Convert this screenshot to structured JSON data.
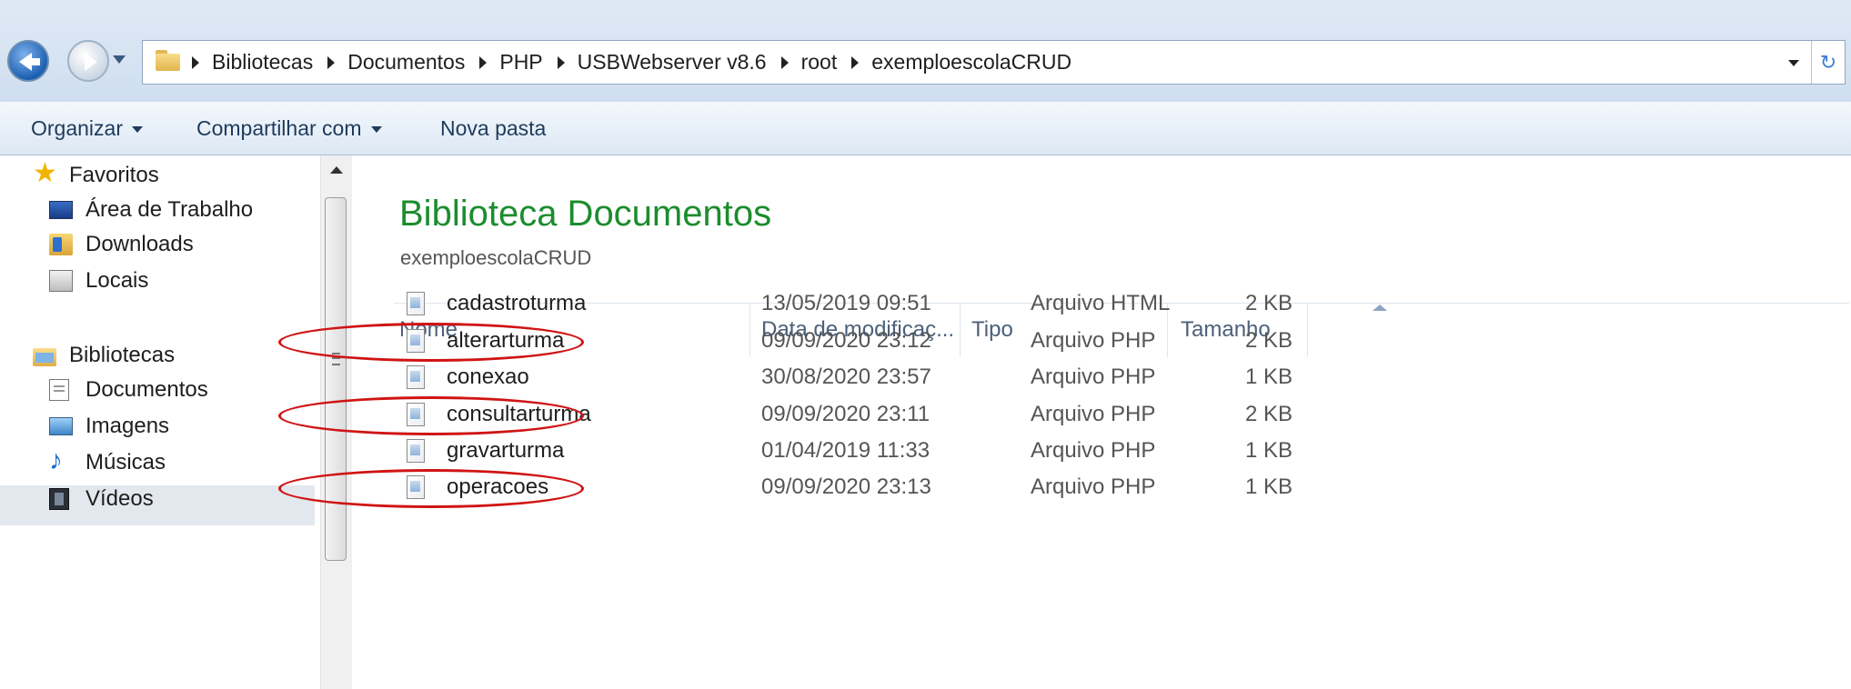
{
  "address_bar": {
    "breadcrumbs": [
      "Bibliotecas",
      "Documentos",
      "PHP",
      "USBWebserver v8.6",
      "root",
      "exemploescolaCRUD"
    ]
  },
  "toolbar": {
    "organize": "Organizar",
    "share": "Compartilhar com",
    "new_folder": "Nova pasta"
  },
  "sidebar": {
    "favorites_header": "Favoritos",
    "favorites": [
      "Área de Trabalho",
      "Downloads",
      "Locais"
    ],
    "libraries_header": "Bibliotecas",
    "libraries": [
      "Documentos",
      "Imagens",
      "Músicas",
      "Vídeos"
    ],
    "selected": "Documentos"
  },
  "library": {
    "title": "Biblioteca Documentos",
    "subtitle": "exemploescolaCRUD"
  },
  "columns": {
    "name": "Nome",
    "date": "Data de modificaç...",
    "type": "Tipo",
    "size": "Tamanho"
  },
  "files": [
    {
      "name": "cadastroturma",
      "date": "13/05/2019 09:51",
      "type": "Arquivo HTML",
      "size": "2 KB",
      "circled": false
    },
    {
      "name": "alterarturma",
      "date": "09/09/2020 23:12",
      "type": "Arquivo PHP",
      "size": "2 KB",
      "circled": true
    },
    {
      "name": "conexao",
      "date": "30/08/2020 23:57",
      "type": "Arquivo PHP",
      "size": "1 KB",
      "circled": false
    },
    {
      "name": "consultarturma",
      "date": "09/09/2020 23:11",
      "type": "Arquivo PHP",
      "size": "2 KB",
      "circled": true
    },
    {
      "name": "gravarturma",
      "date": "01/04/2019 11:33",
      "type": "Arquivo PHP",
      "size": "1 KB",
      "circled": false
    },
    {
      "name": "operacoes",
      "date": "09/09/2020 23:13",
      "type": "Arquivo PHP",
      "size": "1 KB",
      "circled": true
    }
  ],
  "colors": {
    "annotation": "#d01414",
    "library_title": "#1b8d2d",
    "selection": "#e3e8ee"
  }
}
